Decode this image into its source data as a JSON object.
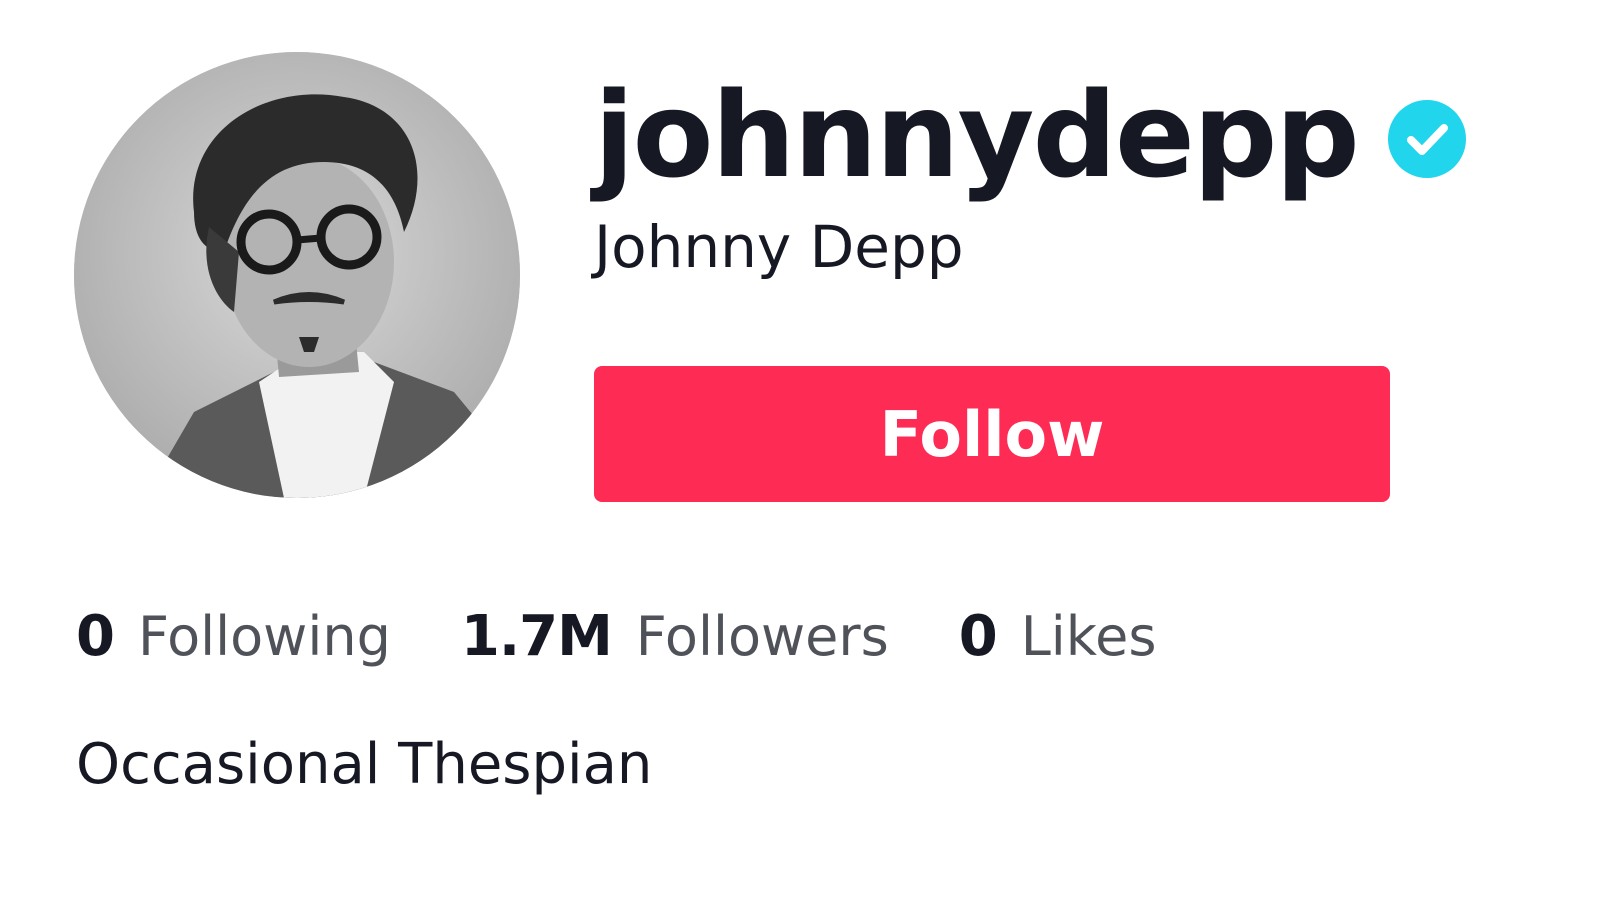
{
  "profile": {
    "username": "johnnydepp",
    "display_name": "Johnny Depp",
    "verified": true,
    "follow_label": "Follow",
    "bio": "Occasional Thespian"
  },
  "stats": [
    {
      "number": "0",
      "label": "Following"
    },
    {
      "number": "1.7M",
      "label": "Followers"
    },
    {
      "number": "0",
      "label": "Likes"
    }
  ],
  "icons": {
    "verified": "verified-checkmark-icon",
    "avatar": "profile-photo"
  },
  "colors": {
    "follow_button": "#fe2c55",
    "verified_badge": "#20d5ec",
    "text_primary": "#161823"
  }
}
